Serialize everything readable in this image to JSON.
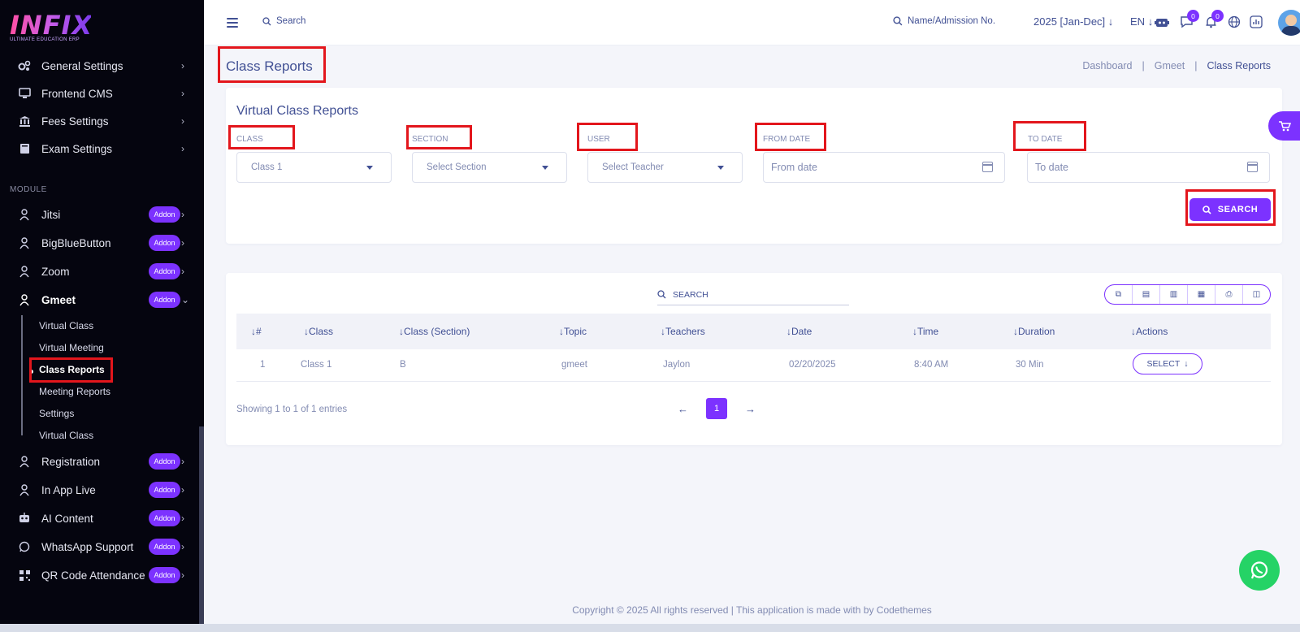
{
  "brand": {
    "logo_text": "INFIX",
    "tagline": "ULTIMATE EDUCATION ERP"
  },
  "sidebar": {
    "items_top": [
      {
        "label": "General Settings",
        "icon": "gears-icon"
      },
      {
        "label": "Frontend CMS",
        "icon": "monitor-icon"
      },
      {
        "label": "Fees Settings",
        "icon": "bank-icon"
      },
      {
        "label": "Exam Settings",
        "icon": "book-icon"
      }
    ],
    "module_label": "MODULE",
    "modules": [
      {
        "label": "Jitsi",
        "badge": "Addon"
      },
      {
        "label": "BigBlueButton",
        "badge": "Addon"
      },
      {
        "label": "Zoom",
        "badge": "Addon"
      },
      {
        "label": "Gmeet",
        "badge": "Addon"
      }
    ],
    "gmeet_sub": [
      "Virtual Class",
      "Virtual Meeting",
      "Class Reports",
      "Meeting Reports",
      "Settings",
      "Virtual Class"
    ],
    "modules_bottom": [
      {
        "label": "Registration",
        "badge": "Addon"
      },
      {
        "label": "In App Live",
        "badge": "Addon"
      },
      {
        "label": "AI Content",
        "badge": "Addon"
      },
      {
        "label": "WhatsApp Support",
        "badge": "Addon"
      },
      {
        "label": "QR Code Attendance",
        "badge": "Addon"
      }
    ]
  },
  "topbar": {
    "search_label": "Search",
    "name_search_label": "Name/Admission No.",
    "year": "2025 [Jan-Dec]",
    "lang": "EN",
    "chat_count": "0",
    "notif_count": "0"
  },
  "page": {
    "title": "Class Reports",
    "breadcrumb": [
      "Dashboard",
      "Gmeet",
      "Class Reports"
    ]
  },
  "filters": {
    "card_title": "Virtual Class Reports",
    "class_label": "CLASS",
    "class_value": "Class 1",
    "section_label": "SECTION",
    "section_placeholder": "Select Section",
    "user_label": "USER",
    "user_placeholder": "Select Teacher",
    "from_label": "FROM DATE",
    "from_placeholder": "From date",
    "to_label": "TO DATE",
    "to_placeholder": "To date",
    "search_button": "SEARCH"
  },
  "table": {
    "search_label": "SEARCH",
    "columns": [
      "#",
      "Class",
      "Class (Section)",
      "Topic",
      "Teachers",
      "Date",
      "Time",
      "Duration",
      "Actions"
    ],
    "rows": [
      {
        "no": "1",
        "class": "Class 1",
        "section": "B",
        "topic": "gmeet",
        "teacher": "Jaylon",
        "date": "02/20/2025",
        "time": "8:40 AM",
        "duration": "30 Min",
        "action": "SELECT"
      }
    ],
    "showing": "Showing 1 to 1 of 1 entries",
    "current_page": "1"
  },
  "footer": {
    "text": "Copyright © 2025 All rights reserved | This application is made with by Codethemes"
  },
  "colors": {
    "accent": "#7c32ff",
    "sidebar_bg": "#05050f",
    "text_primary": "#415094",
    "highlight": "#e3161c",
    "whatsapp": "#25d366"
  }
}
